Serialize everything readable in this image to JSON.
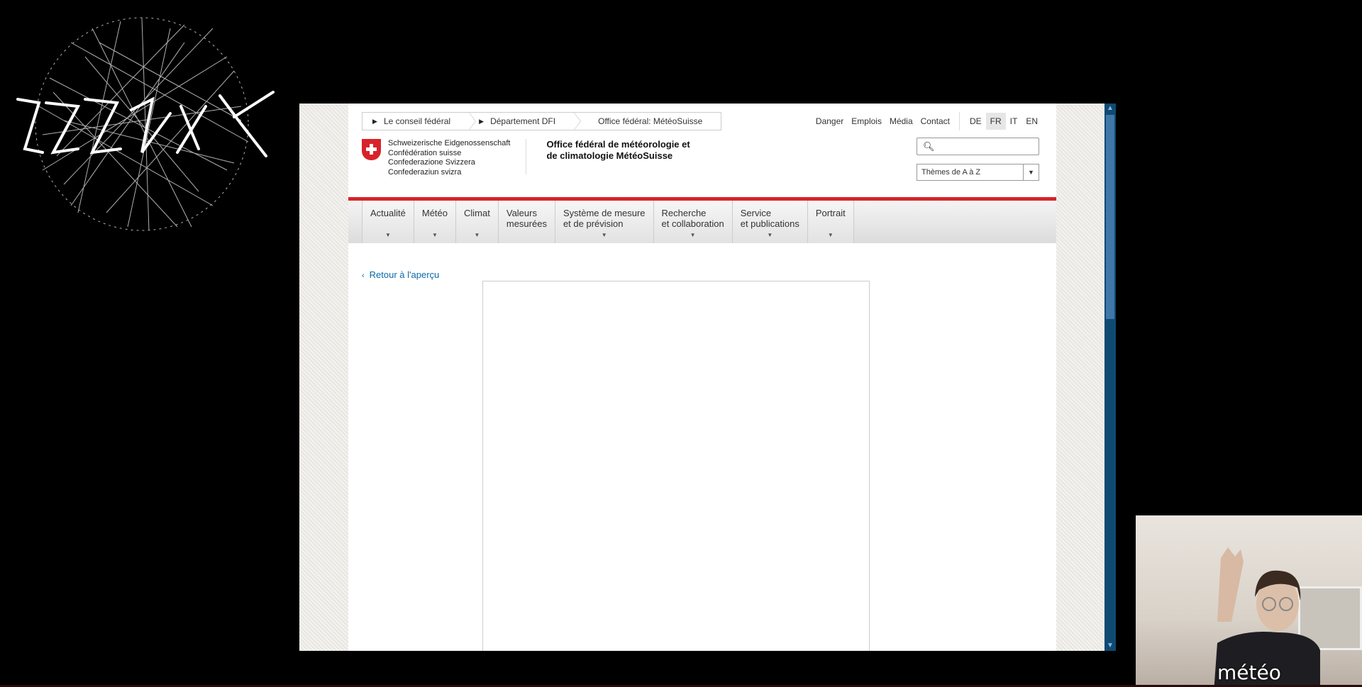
{
  "breadcrumbs": [
    "Le conseil fédéral",
    "Département DFI",
    "Office fédéral: MétéoSuisse"
  ],
  "meta_links": [
    "Danger",
    "Emplois",
    "Média",
    "Contact"
  ],
  "languages": [
    {
      "code": "DE",
      "active": false
    },
    {
      "code": "FR",
      "active": true
    },
    {
      "code": "IT",
      "active": false
    },
    {
      "code": "EN",
      "active": false
    }
  ],
  "brand": {
    "confederation_lines": [
      "Schweizerische Eidgenossenschaft",
      "Confédération suisse",
      "Confederazione Svizzera",
      "Confederaziun svizra"
    ],
    "office_line1": "Office fédéral de météorologie et",
    "office_line2": "de climatologie MétéoSuisse"
  },
  "search": {
    "placeholder": ""
  },
  "themes_select": {
    "value": "Thèmes de A à Z"
  },
  "main_nav": [
    {
      "line1": "Actualité",
      "line2": ""
    },
    {
      "line1": "Météo",
      "line2": ""
    },
    {
      "line1": "Climat",
      "line2": ""
    },
    {
      "line1": "Valeurs",
      "line2": "mesurées"
    },
    {
      "line1": "Système de mesure",
      "line2": "et de prévision"
    },
    {
      "line1": "Recherche",
      "line2": "et collaboration"
    },
    {
      "line1": "Service",
      "line2": "et publications"
    },
    {
      "line1": "Portrait",
      "line2": ""
    }
  ],
  "back_link": "Retour à l'aperçu",
  "webcam": {
    "label": "météo"
  },
  "colors": {
    "swiss_red": "#d8232a",
    "link_blue": "#0b6aa8",
    "scrollbar": "#0f4a73"
  }
}
